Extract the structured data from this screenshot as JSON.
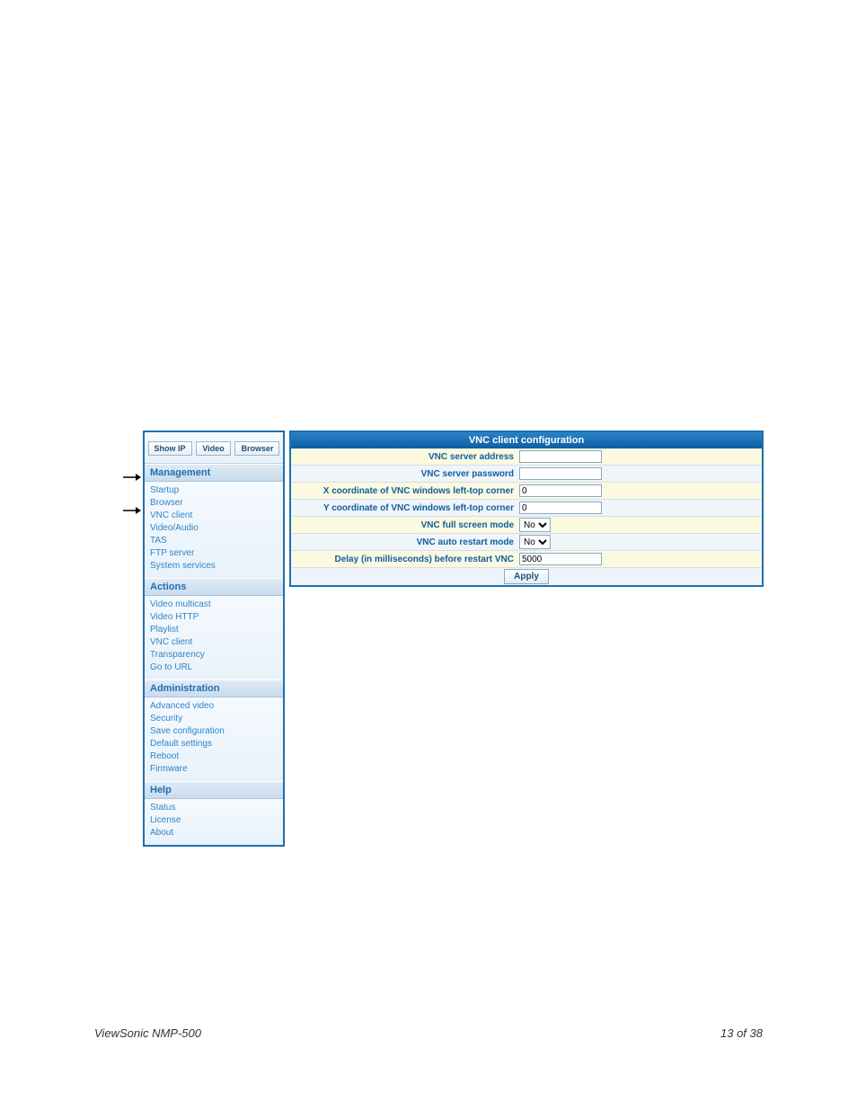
{
  "sidebar": {
    "top_buttons": {
      "show_ip": "Show IP",
      "video": "Video",
      "browser": "Browser"
    },
    "sections": {
      "management": {
        "header": "Management",
        "items": [
          "Startup",
          "Browser",
          "VNC client",
          "Video/Audio",
          "TAS",
          "FTP server",
          "System services"
        ]
      },
      "actions": {
        "header": "Actions",
        "items": [
          "Video multicast",
          "Video HTTP",
          "Playlist",
          "VNC client",
          "Transparency",
          "Go to URL"
        ]
      },
      "administration": {
        "header": "Administration",
        "items": [
          "Advanced video",
          "Security",
          "Save configuration",
          "Default settings",
          "Reboot",
          "Firmware"
        ]
      },
      "help": {
        "header": "Help",
        "items": [
          "Status",
          "License",
          "About"
        ]
      }
    }
  },
  "main": {
    "title": "VNC client configuration",
    "rows": {
      "server_address": {
        "label": "VNC server address",
        "value": ""
      },
      "server_password": {
        "label": "VNC server password",
        "value": ""
      },
      "x_coord": {
        "label": "X coordinate of VNC windows left-top corner",
        "value": "0"
      },
      "y_coord": {
        "label": "Y coordinate of VNC windows left-top corner",
        "value": "0"
      },
      "full_screen": {
        "label": "VNC full screen mode",
        "value": "No"
      },
      "auto_restart": {
        "label": "VNC auto restart mode",
        "value": "No"
      },
      "delay": {
        "label": "Delay (in milliseconds) before restart VNC",
        "value": "5000"
      }
    },
    "apply_label": "Apply"
  },
  "footer": {
    "left": "ViewSonic NMP-500",
    "right": "13 of  38"
  }
}
